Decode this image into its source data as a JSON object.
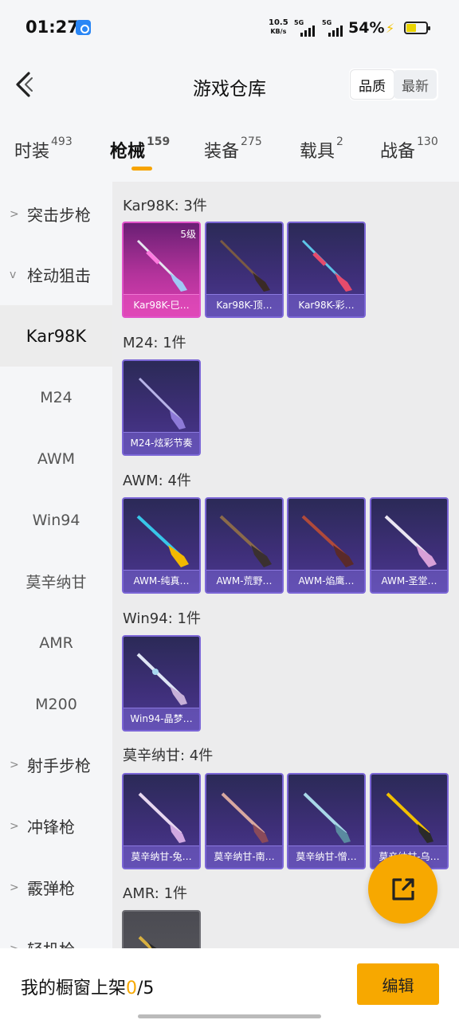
{
  "status": {
    "time": "01:27",
    "net_speed_value": "10.5",
    "net_speed_unit": "KB/s",
    "sig1": "5G",
    "sig2": "5G",
    "battery": "54%"
  },
  "header": {
    "title": "游戏仓库",
    "sort_quality": "品质",
    "sort_latest": "最新"
  },
  "tabs": [
    {
      "label": "时装",
      "count": "493"
    },
    {
      "label": "枪械",
      "count": "159"
    },
    {
      "label": "装备",
      "count": "275"
    },
    {
      "label": "载具",
      "count": "2"
    },
    {
      "label": "战备",
      "count": "130"
    }
  ],
  "sidenav": {
    "assault": "突击步枪",
    "bolt": "栓动狙击",
    "kar98k": "Kar98K",
    "m24": "M24",
    "awm": "AWM",
    "win94": "Win94",
    "mosin": "莫辛纳甘",
    "amr": "AMR",
    "m200": "M200",
    "marksman": "射手步枪",
    "smg": "冲锋枪",
    "shotgun": "霰弹枪",
    "lmg": "轻机枪"
  },
  "groups": {
    "kar98k": {
      "title": "Kar98K: 3件",
      "items": [
        {
          "name": "Kar98K-巳…",
          "level": "5级"
        },
        {
          "name": "Kar98K-顶…"
        },
        {
          "name": "Kar98K-彩…"
        }
      ]
    },
    "m24": {
      "title": "M24: 1件",
      "items": [
        {
          "name": "M24-炫彩节奏"
        }
      ]
    },
    "awm": {
      "title": "AWM: 4件",
      "items": [
        {
          "name": "AWM-纯真…"
        },
        {
          "name": "AWM-荒野…"
        },
        {
          "name": "AWM-焰鹰…"
        },
        {
          "name": "AWM-圣堂…"
        }
      ]
    },
    "win94": {
      "title": "Win94: 1件",
      "items": [
        {
          "name": "Win94-晶梦…"
        }
      ]
    },
    "mosin": {
      "title": "莫辛纳甘: 4件",
      "items": [
        {
          "name": "莫辛纳甘-兔…"
        },
        {
          "name": "莫辛纳甘-南…"
        },
        {
          "name": "莫辛纳甘-憎…"
        },
        {
          "name": "莫辛纳甘-乌…"
        }
      ]
    },
    "amr": {
      "title": "AMR: 1件"
    }
  },
  "bottom": {
    "showcase_label": "我的橱窗上架",
    "showcase_count": "0",
    "showcase_total": "/5",
    "edit": "编辑"
  },
  "colors": {
    "accent": "#f7a800",
    "card_purple": "#3f2f7a",
    "card_pink": "#d93fb1"
  }
}
